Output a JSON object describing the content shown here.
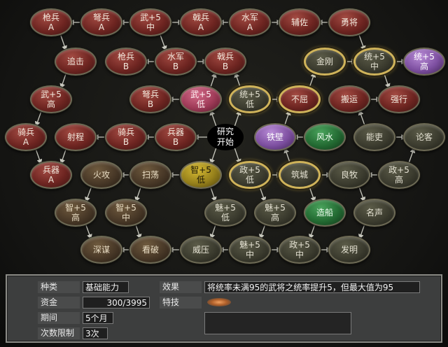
{
  "nodes": [
    {
      "id": "n1",
      "lines": [
        "枪兵",
        "A"
      ],
      "color": "red"
    },
    {
      "id": "n2",
      "lines": [
        "弩兵",
        "A"
      ],
      "color": "red"
    },
    {
      "id": "n3",
      "lines": [
        "武+5",
        "中"
      ],
      "color": "red"
    },
    {
      "id": "n4",
      "lines": [
        "戟兵",
        "A"
      ],
      "color": "red"
    },
    {
      "id": "n5",
      "lines": [
        "水军",
        "A"
      ],
      "color": "red"
    },
    {
      "id": "n6",
      "lines": [
        "辅佐"
      ],
      "color": "red"
    },
    {
      "id": "n7",
      "lines": [
        "勇将"
      ],
      "color": "red"
    },
    {
      "id": "n8",
      "lines": [
        "追击"
      ],
      "color": "red"
    },
    {
      "id": "n9",
      "lines": [
        "枪兵",
        "B"
      ],
      "color": "red"
    },
    {
      "id": "n10",
      "lines": [
        "水军",
        "B"
      ],
      "color": "red"
    },
    {
      "id": "n11",
      "lines": [
        "戟兵",
        "B"
      ],
      "color": "red"
    },
    {
      "id": "n12",
      "lines": [
        "金刚"
      ],
      "color": "olive",
      "gold": true
    },
    {
      "id": "n13",
      "lines": [
        "统+5",
        "中"
      ],
      "color": "olive",
      "gold": true
    },
    {
      "id": "n14",
      "lines": [
        "统+5",
        "高"
      ],
      "color": "purple"
    },
    {
      "id": "n15",
      "lines": [
        "武+5",
        "高"
      ],
      "color": "red"
    },
    {
      "id": "n16",
      "lines": [
        "弩兵",
        "B"
      ],
      "color": "red"
    },
    {
      "id": "n17",
      "lines": [
        "武+5",
        "低"
      ],
      "color": "pink"
    },
    {
      "id": "n18",
      "lines": [
        "统+5",
        "低"
      ],
      "color": "olive",
      "gold": true
    },
    {
      "id": "n19",
      "lines": [
        "不屈"
      ],
      "color": "red",
      "gold": true
    },
    {
      "id": "n20",
      "lines": [
        "搬运"
      ],
      "color": "red"
    },
    {
      "id": "n21",
      "lines": [
        "强行"
      ],
      "color": "red"
    },
    {
      "id": "n22",
      "lines": [
        "骑兵",
        "A"
      ],
      "color": "red"
    },
    {
      "id": "n23",
      "lines": [
        "射程"
      ],
      "color": "red"
    },
    {
      "id": "n24",
      "lines": [
        "骑兵",
        "B"
      ],
      "color": "red"
    },
    {
      "id": "n25",
      "lines": [
        "兵器",
        "B"
      ],
      "color": "red"
    },
    {
      "id": "n26",
      "lines": [
        "铁壁"
      ],
      "color": "purple"
    },
    {
      "id": "n27",
      "lines": [
        "风水"
      ],
      "color": "green"
    },
    {
      "id": "n28",
      "lines": [
        "能吏"
      ],
      "color": "olive"
    },
    {
      "id": "n29",
      "lines": [
        "论客"
      ],
      "color": "olive"
    },
    {
      "id": "n30",
      "lines": [
        "兵器",
        "A"
      ],
      "color": "red"
    },
    {
      "id": "n31",
      "lines": [
        "火攻"
      ],
      "color": "brown"
    },
    {
      "id": "n32",
      "lines": [
        "扫荡"
      ],
      "color": "brown"
    },
    {
      "id": "n33",
      "lines": [
        "智+5",
        "低"
      ],
      "color": "yellow"
    },
    {
      "id": "n34",
      "lines": [
        "政+5",
        "低"
      ],
      "color": "olive",
      "gold": true
    },
    {
      "id": "n35",
      "lines": [
        "筑城"
      ],
      "color": "olive",
      "gold": true
    },
    {
      "id": "n36",
      "lines": [
        "良牧"
      ],
      "color": "olive"
    },
    {
      "id": "n37",
      "lines": [
        "政+5",
        "高"
      ],
      "color": "olive"
    },
    {
      "id": "n38",
      "lines": [
        "智+5",
        "高"
      ],
      "color": "brown"
    },
    {
      "id": "n39",
      "lines": [
        "智+5",
        "中"
      ],
      "color": "brown"
    },
    {
      "id": "n40",
      "lines": [
        "魅+5",
        "低"
      ],
      "color": "olive"
    },
    {
      "id": "n41",
      "lines": [
        "魅+5",
        "高"
      ],
      "color": "olive"
    },
    {
      "id": "n42",
      "lines": [
        "造船"
      ],
      "color": "green"
    },
    {
      "id": "n43",
      "lines": [
        "名声"
      ],
      "color": "olive"
    },
    {
      "id": "n44",
      "lines": [
        "深谋"
      ],
      "color": "brown"
    },
    {
      "id": "n45",
      "lines": [
        "看破"
      ],
      "color": "brown"
    },
    {
      "id": "n46",
      "lines": [
        "威压"
      ],
      "color": "olive"
    },
    {
      "id": "n47",
      "lines": [
        "魅+5",
        "中"
      ],
      "color": "olive"
    },
    {
      "id": "n48",
      "lines": [
        "政+5",
        "中"
      ],
      "color": "olive"
    },
    {
      "id": "n49",
      "lines": [
        "发明"
      ],
      "color": "olive"
    }
  ],
  "start": {
    "lines": [
      "研究",
      "开始"
    ]
  },
  "colors": {
    "line": "#c9c9bf",
    "gold_border": "#cfb35a"
  },
  "info": {
    "category_label": "种类",
    "category_value": "基础能力",
    "funds_label": "资金",
    "funds_value": "300/3995",
    "period_label": "期间",
    "period_value": "5个月",
    "limit_label": "次数限制",
    "limit_value": "3次",
    "effect_label": "效果",
    "effect_value": "将统率未满95的武将之统率提升5，但最大值为95",
    "skill_label": "特技"
  }
}
